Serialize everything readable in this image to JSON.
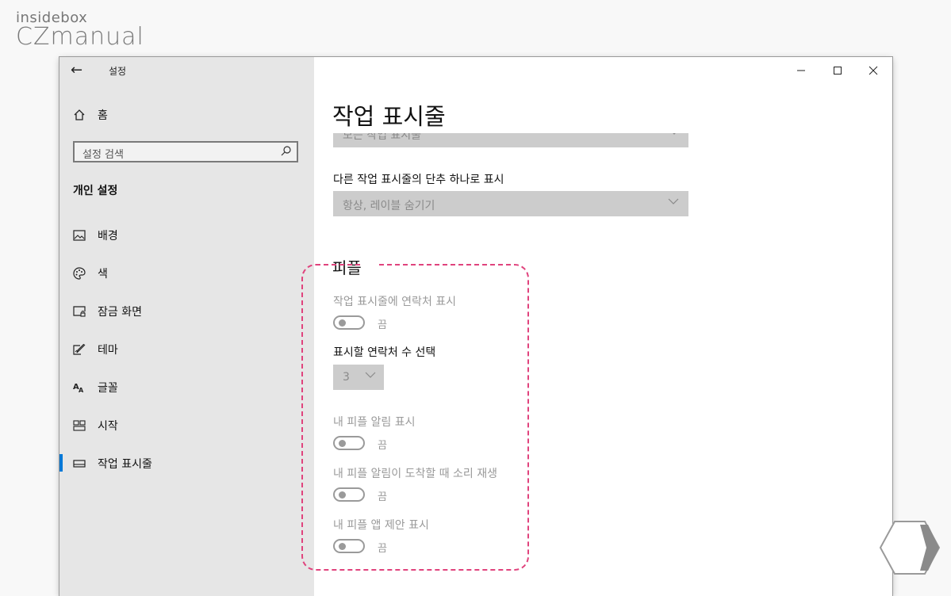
{
  "logo": {
    "line1": "insidebox",
    "line2": "CZmanual"
  },
  "window": {
    "title": "설정",
    "controls": {
      "minimize": "—",
      "maximize": "☐",
      "close": "✕"
    }
  },
  "sidebar": {
    "home_label": "홈",
    "search_placeholder": "설정 검색",
    "section_header": "개인 설정",
    "items": [
      {
        "label": "배경",
        "icon": "picture-icon"
      },
      {
        "label": "색",
        "icon": "palette-icon"
      },
      {
        "label": "잠금 화면",
        "icon": "lock-screen-icon"
      },
      {
        "label": "테마",
        "icon": "theme-icon"
      },
      {
        "label": "글꼴",
        "icon": "font-icon"
      },
      {
        "label": "시작",
        "icon": "start-icon"
      },
      {
        "label": "작업 표시줄",
        "icon": "taskbar-icon",
        "active": true
      }
    ]
  },
  "main": {
    "title": "작업 표시줄",
    "top_dropdown_value": "모든 작업 표시줄",
    "combine_label": "다른 작업 표시줄의 단추 하나로 표시",
    "combine_value": "항상, 레이블 숨기기",
    "people": {
      "header": "피플",
      "show_contacts_label": "작업 표시줄에 연락처 표시",
      "show_contacts_state": "끔",
      "contacts_count_label": "표시할 연락처 수 선택",
      "contacts_count_value": "3",
      "notifications_label": "내 피플 알림 표시",
      "notifications_state": "끔",
      "sound_label": "내 피플 알림이 도착할 때 소리 재생",
      "sound_state": "끔",
      "suggestions_label": "내 피플 앱 제안 표시",
      "suggestions_state": "끔"
    }
  },
  "colors": {
    "accent": "#0078d7",
    "highlight": "#e0437d",
    "sidebar_bg": "#e6e6e6"
  }
}
